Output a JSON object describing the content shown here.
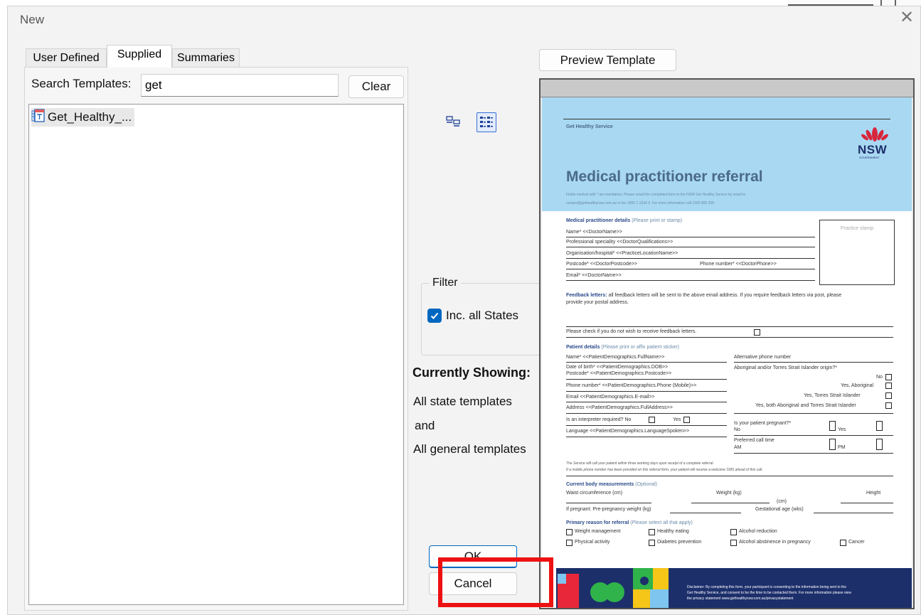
{
  "window": {
    "title": "New",
    "close_glyph": "✕"
  },
  "tabs": [
    {
      "label": "User Defined"
    },
    {
      "label": "Supplied"
    },
    {
      "label": "Summaries"
    }
  ],
  "search": {
    "label": "Search Templates:",
    "value": "get",
    "clear_label": "Clear"
  },
  "template_list": [
    {
      "label": "Get_Healthy_...",
      "icon": "template-doc-icon"
    }
  ],
  "view_toggle": {
    "single_icon": "single-view-icon",
    "grid_icon": "grid-view-icon"
  },
  "filter": {
    "legend": "Filter",
    "include_all_states_label": "Inc. all States",
    "include_all_states_checked": true
  },
  "showing": {
    "title": "Currently Showing:",
    "line1": "All state templates",
    "line2": "and",
    "line3": "All general templates"
  },
  "buttons": {
    "ok": "OK",
    "cancel": "Cancel",
    "preview": "Preview Template"
  },
  "preview_doc": {
    "service": "Get Healthy Service",
    "logo_text": "NSW",
    "logo_sub": "GOVERNMENT",
    "title": "Medical practitioner referral",
    "intro1": "Fields marked with * are mandatory. Please email the completed form to the NSW Get Healthy Service by email to",
    "intro2": "contact@gethealthynsw.com.au or fax 1800 1 1334 3. For more information call 1300 806 258",
    "sec_doctor": "Medical practitioner details",
    "sec_doctor_hint": "(Please print or stamp)",
    "stamp": "Practice stamp",
    "f_name": "Name*  <<DoctorName>>",
    "f_prof": "Professional speciality <<DoctorQualifications>>",
    "f_org": "Organisation/hospital*  <<PracticeLocationName>>",
    "f_postcode": "Postcode*  <<DoctorPostcode>>",
    "f_phone": "Phone number*  <<DoctorPhone>>",
    "f_email": "Email*  <<DoctorName>>",
    "feedback_bold": "Feedback letters:",
    "feedback_text": "all feedback letters will be sent to the above email address. If you require feedback letters via post, please",
    "feedback_text2": "provide your postal address.",
    "feedback_check": "Please check if you do not wish to receive feedback letters.",
    "sec_patient": "Patient details",
    "sec_patient_hint": "(Please print or affix patient sticker)",
    "p_name": "Name*  <<PatientDemographics.FullName>>",
    "p_dob": "Date of birth*  <<PatientDemographics.DOB>>",
    "p_postcode": "Postcode*  <<PatientDemographics.Postcode>>",
    "p_phone": "Phone number*  <<PatientDemographics.Phone (Mobile)>>",
    "p_email": "Email  <<PatientDemographics.E-mail>>",
    "p_address": "Address  <<PatientDemographics.FullAddress>>",
    "p_interp": "Is an interpreter required?   No",
    "p_interp_yes": "Yes",
    "p_lang": "Language <<PatientDemographics.LanguageSpoken>>",
    "alt_phone": "Alternative phone number",
    "aboriginal": "Aboriginal and/or Torres Strait Islander origin?*",
    "ab_no": "No",
    "ab_yes": "Yes, Aboriginal",
    "ab_tsi": "Yes, Torres Strait Islander",
    "ab_both": "Yes, both Aboriginal and Torres Strait Islander",
    "pregnant": "Is your patient pregnant?*",
    "preg_no": "No",
    "preg_yes": "Yes",
    "call_time": "Preferred call time",
    "call_am": "AM",
    "call_pm": "PM",
    "note1": "The Service will call your patient within three working days upon receipt of a complete referral.",
    "note2": "If a mobile phone number has been provided on this referral form, your patient will receive a welcome SMS ahead of this call.",
    "sec_body": "Current body measurements",
    "sec_body_hint": "(Optional)",
    "waist": "Waist circumference (cm)",
    "weight": "Weight (kg)",
    "height": "Height",
    "height_unit": "(cm)",
    "preg_weight": "If pregnant: Pre-pregnancy weight (kg)",
    "gest_age": "Gestational age (wks)",
    "sec_reason": "Primary reason for referral",
    "sec_reason_hint": "(Please select all that apply)",
    "r1": "Weight management",
    "r2": "Healthy eating",
    "r3": "Alcohol reduction",
    "r4": "Physical activity",
    "r5": "Diabetes prevention",
    "r6": "Alcohol abstinence in pregnancy",
    "r7": "Cancer",
    "disclaimer1": "Disclaimer: By completing this form, your participant is consenting to the information being sent to the",
    "disclaimer2": "Get Healthy Service, and consent to be the time to be contacted them. For more information please view",
    "disclaimer3": "the privacy statement www.gethealthynsw.com.au/privacystatement"
  },
  "colors": {
    "accent": "#0067c0",
    "highlight": "#ee1111",
    "doc_blue": "#a9d8f2",
    "doc_navy": "#1c2f6b",
    "doc_title": "#4a6a8a"
  }
}
